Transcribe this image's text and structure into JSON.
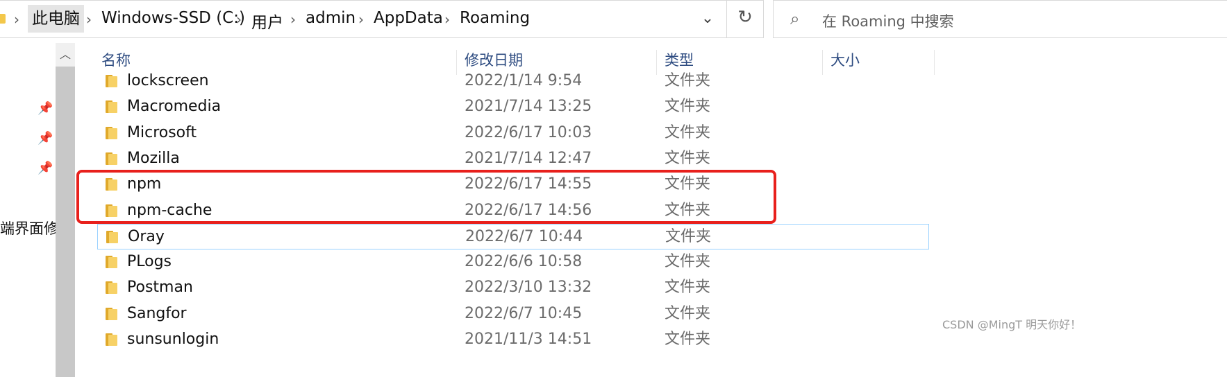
{
  "address_bar": {
    "breadcrumbs": [
      "此电脑",
      "Windows-SSD (C:)",
      "用户",
      "admin",
      "AppData",
      "Roaming"
    ],
    "separator": "›"
  },
  "search": {
    "placeholder": "在 Roaming 中搜索"
  },
  "nav": {
    "partial_label": "端界面修"
  },
  "columns": {
    "name": "名称",
    "date": "修改日期",
    "type": "类型",
    "size": "大小"
  },
  "rows": [
    {
      "name": "lockscreen",
      "date": "2022/1/14 9:54",
      "type": "文件夹"
    },
    {
      "name": "Macromedia",
      "date": "2021/7/14 13:25",
      "type": "文件夹"
    },
    {
      "name": "Microsoft",
      "date": "2022/6/17 10:03",
      "type": "文件夹"
    },
    {
      "name": "Mozilla",
      "date": "2021/7/14 12:47",
      "type": "文件夹"
    },
    {
      "name": "npm",
      "date": "2022/6/17 14:55",
      "type": "文件夹"
    },
    {
      "name": "npm-cache",
      "date": "2022/6/17 14:56",
      "type": "文件夹"
    },
    {
      "name": "Oray",
      "date": "2022/6/7 10:44",
      "type": "文件夹"
    },
    {
      "name": "PLogs",
      "date": "2022/6/6 10:58",
      "type": "文件夹"
    },
    {
      "name": "Postman",
      "date": "2022/3/10 13:32",
      "type": "文件夹"
    },
    {
      "name": "Sangfor",
      "date": "2022/6/7 10:45",
      "type": "文件夹"
    },
    {
      "name": "sunsunlogin",
      "date": "2021/11/3 14:51",
      "type": "文件夹"
    }
  ],
  "watermark": "CSDN @MingT 明天你好！",
  "colors": {
    "highlight_border": "#e8201c",
    "header_text": "#2d4b80",
    "focus_border": "#99d1ff",
    "folder_yellow": "#f7d166"
  }
}
